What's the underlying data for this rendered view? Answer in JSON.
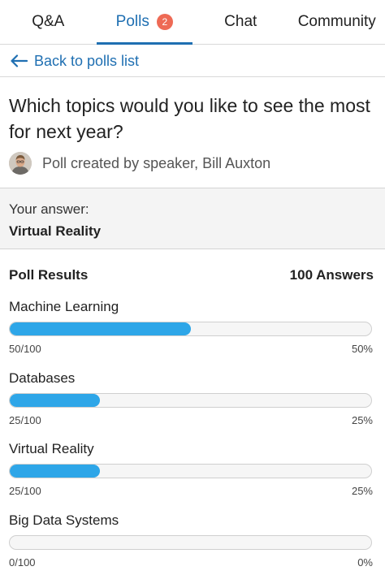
{
  "tabs": [
    {
      "label": "Q&A"
    },
    {
      "label": "Polls",
      "badge": "2"
    },
    {
      "label": "Chat"
    },
    {
      "label": "Community"
    }
  ],
  "back": {
    "label": "Back to polls list"
  },
  "question": "Which topics would you like to see the most for next year?",
  "creator": "Poll created by speaker, Bill Auxton",
  "answer": {
    "label": "Your answer:",
    "value": "Virtual Reality"
  },
  "results": {
    "title": "Poll Results",
    "count": "100 Answers",
    "options": [
      {
        "label": "Machine Learning",
        "count": "50/100",
        "percent": "50%",
        "fraction": 0.5
      },
      {
        "label": "Databases",
        "count": "25/100",
        "percent": "25%",
        "fraction": 0.25
      },
      {
        "label": "Virtual Reality",
        "count": "25/100",
        "percent": "25%",
        "fraction": 0.25
      },
      {
        "label": "Big Data Systems",
        "count": "0/100",
        "percent": "0%",
        "fraction": 0
      }
    ]
  },
  "colors": {
    "accent": "#1f6fb2",
    "badge": "#ee6a55",
    "bar": "#2ea6e8"
  }
}
